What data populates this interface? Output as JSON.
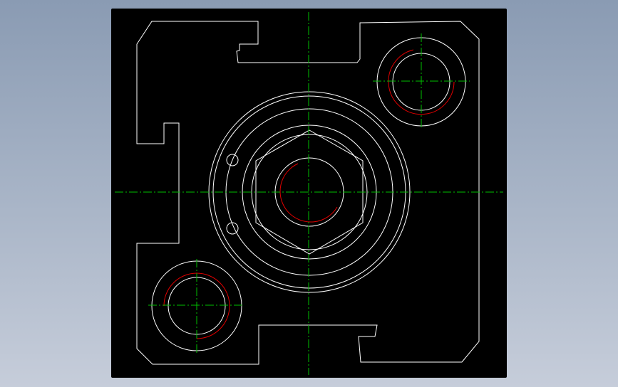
{
  "drawing": {
    "background": "#000000",
    "colors": {
      "outline": "#ffffff",
      "hidden_arc": "#e00000",
      "centerline": "#00c000"
    },
    "features": [
      "body-outline",
      "central-boss-circles",
      "hex-nut",
      "central-bore",
      "top-right-mounting-hole",
      "bottom-left-mounting-hole",
      "slot-arcs",
      "centerlines"
    ]
  }
}
